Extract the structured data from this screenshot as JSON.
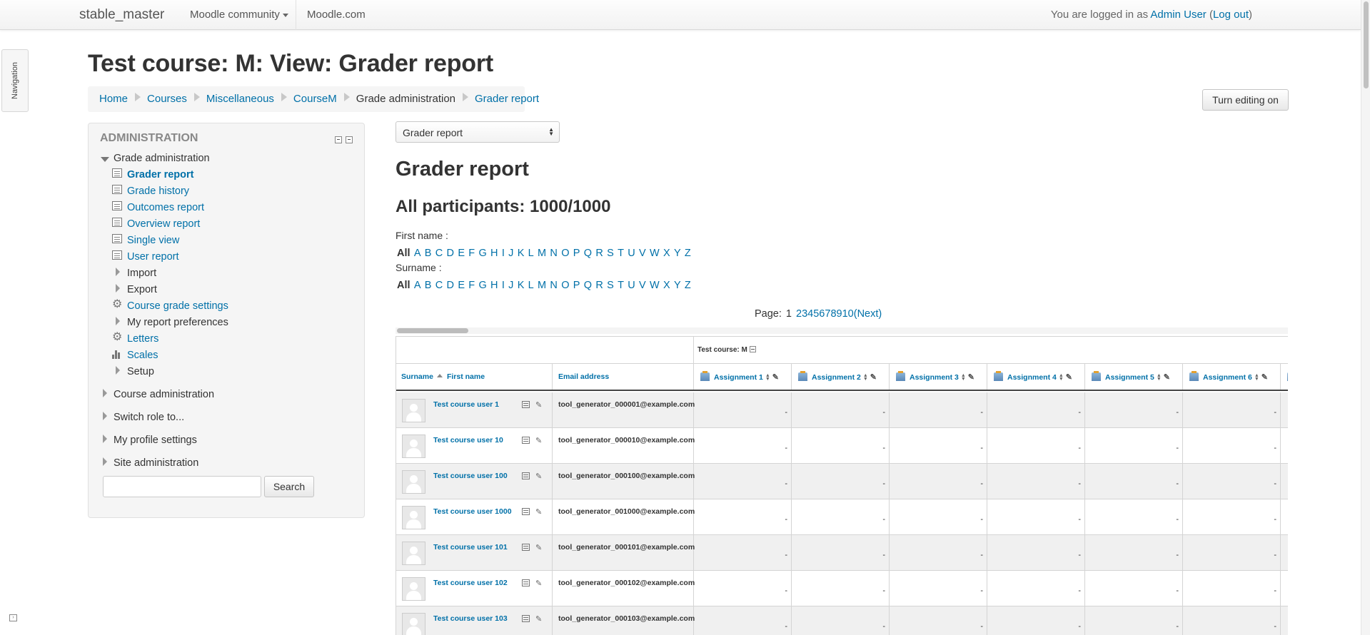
{
  "navbar": {
    "brand": "stable_master",
    "community": "Moodle community",
    "moodle_com": "Moodle.com",
    "login_prefix": "You are logged in as ",
    "login_user": "Admin User",
    "logout_open": " (",
    "logout": "Log out",
    "logout_close": ")"
  },
  "nav_tab": {
    "label": "Navigation"
  },
  "page": {
    "title": "Test course: M: View: Grader report",
    "turn_editing": "Turn editing on"
  },
  "breadcrumb": [
    {
      "label": "Home"
    },
    {
      "label": "Courses"
    },
    {
      "label": "Miscellaneous"
    },
    {
      "label": "CourseM"
    },
    {
      "label": "Grade administration"
    },
    {
      "label": "Grader report"
    }
  ],
  "admin": {
    "title": "ADMINISTRATION",
    "grade_admin": "Grade administration",
    "grader_report": "Grader report",
    "grade_history": "Grade history",
    "outcomes_report": "Outcomes report",
    "overview_report": "Overview report",
    "single_view": "Single view",
    "user_report": "User report",
    "import": "Import",
    "export": "Export",
    "course_grade_settings": "Course grade settings",
    "my_report_preferences": "My report preferences",
    "letters": "Letters",
    "scales": "Scales",
    "setup": "Setup",
    "course_admin": "Course administration",
    "switch_role": "Switch role to...",
    "my_profile_settings": "My profile settings",
    "site_admin": "Site administration",
    "search_button": "Search"
  },
  "main": {
    "select_value": "Grader report",
    "heading": "Grader report",
    "participants": "All participants: 1000/1000",
    "first_name_label": "First name :",
    "surname_label": "Surname :",
    "initials_all": "All",
    "letters": [
      "A",
      "B",
      "C",
      "D",
      "E",
      "F",
      "G",
      "H",
      "I",
      "J",
      "K",
      "L",
      "M",
      "N",
      "O",
      "P",
      "Q",
      "R",
      "S",
      "T",
      "U",
      "V",
      "W",
      "X",
      "Y",
      "Z"
    ],
    "page_label": "Page:",
    "pages": [
      "1",
      "2",
      "3",
      "4",
      "5",
      "6",
      "7",
      "8",
      "9",
      "10"
    ],
    "next": "(Next)"
  },
  "table": {
    "category": "Test course: M",
    "col_surname": "Surname",
    "col_firstname": "First name",
    "col_email": "Email address",
    "assignments": [
      "Assignment 1",
      "Assignment 2",
      "Assignment 3",
      "Assignment 4",
      "Assignment 5",
      "Assignment 6"
    ],
    "rows": [
      {
        "name": "Test course user 1",
        "email": "tool_generator_000001@example.com",
        "grades": [
          "-",
          "-",
          "-",
          "-",
          "-",
          "-",
          "-"
        ]
      },
      {
        "name": "Test course user 10",
        "email": "tool_generator_000010@example.com",
        "grades": [
          "-",
          "-",
          "-",
          "-",
          "-",
          "-",
          "-"
        ]
      },
      {
        "name": "Test course user 100",
        "email": "tool_generator_000100@example.com",
        "grades": [
          "-",
          "-",
          "-",
          "-",
          "-",
          "-",
          "-"
        ]
      },
      {
        "name": "Test course user 1000",
        "email": "tool_generator_001000@example.com",
        "grades": [
          "-",
          "-",
          "-",
          "-",
          "-",
          "-",
          "-"
        ]
      },
      {
        "name": "Test course user 101",
        "email": "tool_generator_000101@example.com",
        "grades": [
          "-",
          "-",
          "-",
          "-",
          "-",
          "-",
          "-"
        ]
      },
      {
        "name": "Test course user 102",
        "email": "tool_generator_000102@example.com",
        "grades": [
          "-",
          "-",
          "-",
          "-",
          "-",
          "-",
          "-"
        ]
      },
      {
        "name": "Test course user 103",
        "email": "tool_generator_000103@example.com",
        "grades": [
          "-",
          "-",
          "-",
          "-",
          "-",
          "-",
          "-"
        ]
      }
    ]
  }
}
